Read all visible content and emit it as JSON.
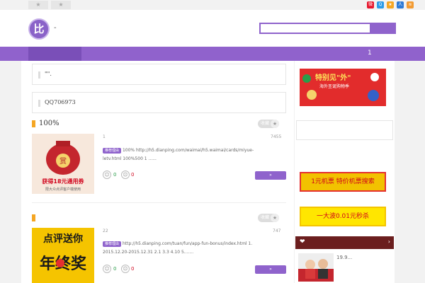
{
  "topbar": {
    "fav_items": [
      "★",
      "★"
    ],
    "social_icons": [
      {
        "name": "weibo-icon",
        "color": "#e6162d"
      },
      {
        "name": "qzone-icon",
        "color": "#2b9be8"
      },
      {
        "name": "star-icon",
        "color": "#f5a623"
      },
      {
        "name": "people-icon",
        "color": "#2d7ad6"
      },
      {
        "name": "rss-icon",
        "color": "#f29b33"
      }
    ]
  },
  "header": {
    "logo_text": "比",
    "logo_dash": "-",
    "search_placeholder": ""
  },
  "nav": {
    "number": "1"
  },
  "notices": [
    {
      "text": "\"\"."
    },
    {
      "text": "QQ706973"
    }
  ],
  "posts": [
    {
      "title": "100%",
      "collect_label": "收藏",
      "meta_left": "1",
      "meta_right": "7455",
      "tag": "推荐理由",
      "desc": "100%  http://h5.dianping.com/waimai/h5.waimai/cards/miyue-letv.html    100%500 1 ......",
      "up": "0",
      "down": "0",
      "button": "»",
      "thumb_lines": [
        "赏",
        "获得18元通用券",
        "限大众点评客户端使用"
      ]
    },
    {
      "title": "",
      "collect_label": "收藏",
      "meta_left": "22",
      "meta_right": "747",
      "tag": "推荐理由",
      "desc": "http://h5.dianping.com/tuan/fun/app-fun-bonus/index.html  1. 2015.12.20-2015.12.31 2.1 3.3 4.10 5.......",
      "up": "0",
      "down": "0",
      "button": "»",
      "thumb_lines": [
        "点评送你",
        "年终奖"
      ]
    }
  ],
  "sidebar": {
    "banner_title": "特别见\"外\"",
    "banner_sub": "海外圣诞购物季",
    "ad_red": "1元机票  特价机票搜索",
    "ad_yellow": "一大波0.01元秒杀",
    "hot_icon": "❤",
    "hot_arrow": "›",
    "hot_item_text": "19.9..."
  }
}
